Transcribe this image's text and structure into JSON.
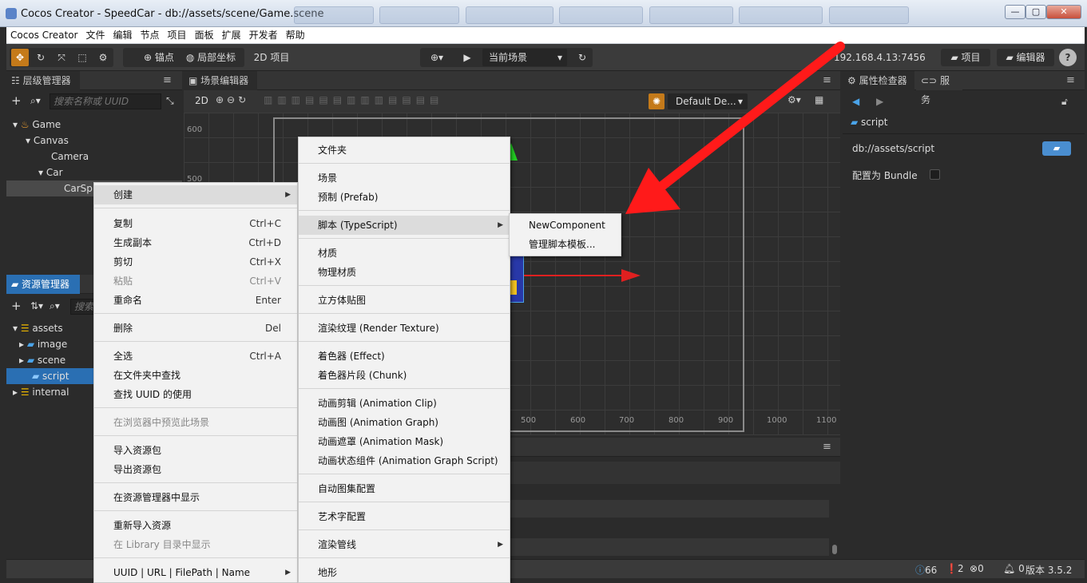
{
  "window": {
    "title": "Cocos Creator - SpeedCar - db://assets/scene/Game.scene",
    "min": "—",
    "max": "▢",
    "close": "✕"
  },
  "menubar": [
    "Cocos Creator",
    "文件",
    "编辑",
    "节点",
    "项目",
    "面板",
    "扩展",
    "开发者",
    "帮助"
  ],
  "toolbar": {
    "anchor_label": "锚点",
    "local_label": "局部坐标",
    "project_2d_label": "2D 项目",
    "scene_select": "当前场景",
    "ip": "192.168.4.13:7456",
    "project_btn": "项目",
    "editor_btn": "编辑器",
    "help": "?"
  },
  "hierarchy": {
    "tab": "层级管理器",
    "search_placeholder": "搜索名称或 UUID",
    "nodes": [
      "Game",
      "Canvas",
      "Camera",
      "Car",
      "CarSp"
    ]
  },
  "assets": {
    "tab": "资源管理器",
    "search_placeholder": "搜索",
    "items": [
      "assets",
      "image",
      "scene",
      "script",
      "internal"
    ]
  },
  "scene": {
    "tab": "场景编辑器",
    "mode_2d": "2D",
    "layer_select": "Default De...",
    "ruler_y": [
      "600",
      "500"
    ],
    "ruler_x": [
      "500",
      "600",
      "700",
      "800",
      "900",
      "1000",
      "1100"
    ]
  },
  "inspector": {
    "tab": "属性检查器",
    "tab2": "服务",
    "asset_name": "script",
    "url": "db://assets/script",
    "bundle_label": "配置为 Bundle"
  },
  "statusbar": {
    "info": "66",
    "warn": "2",
    "err": "0",
    "notice": "0",
    "version": "版本 3.5.2"
  },
  "context_main": [
    {
      "label": "创建",
      "shortcut": "",
      "sub": true
    },
    {
      "label": "复制",
      "shortcut": "Ctrl+C"
    },
    {
      "label": "生成副本",
      "shortcut": "Ctrl+D"
    },
    {
      "label": "剪切",
      "shortcut": "Ctrl+X"
    },
    {
      "label": "粘贴",
      "shortcut": "Ctrl+V"
    },
    {
      "label": "重命名",
      "shortcut": "Enter"
    },
    {
      "label": "删除",
      "shortcut": "Del"
    },
    {
      "label": "全选",
      "shortcut": "Ctrl+A"
    },
    {
      "label": "在文件夹中查找",
      "shortcut": ""
    },
    {
      "label": "查找 UUID 的使用",
      "shortcut": ""
    },
    {
      "label": "在浏览器中预览此场景",
      "shortcut": ""
    },
    {
      "label": "导入资源包",
      "shortcut": ""
    },
    {
      "label": "导出资源包",
      "shortcut": ""
    },
    {
      "label": "在资源管理器中显示",
      "shortcut": ""
    },
    {
      "label": "重新导入资源",
      "shortcut": ""
    },
    {
      "label": "在 Library 目录中显示",
      "shortcut": ""
    },
    {
      "label": "UUID | URL | FilePath | Name",
      "shortcut": "",
      "sub": true
    }
  ],
  "context_create": [
    "文件夹",
    "场景",
    "预制 (Prefab)",
    "脚本 (TypeScript)",
    "材质",
    "物理材质",
    "立方体贴图",
    "渲染纹理 (Render Texture)",
    "着色器 (Effect)",
    "着色器片段 (Chunk)",
    "动画剪辑 (Animation Clip)",
    "动画图 (Animation Graph)",
    "动画遮罩 (Animation Mask)",
    "动画状态组件 (Animation Graph Script)",
    "自动图集配置",
    "艺术字配置",
    "渲染管线",
    "地形"
  ],
  "context_script": [
    "NewComponent",
    "管理脚本模板..."
  ],
  "colors": {
    "accent": "#2a6fb3",
    "arrow": "#ff1a1a",
    "folder": "#4aa3e8"
  }
}
